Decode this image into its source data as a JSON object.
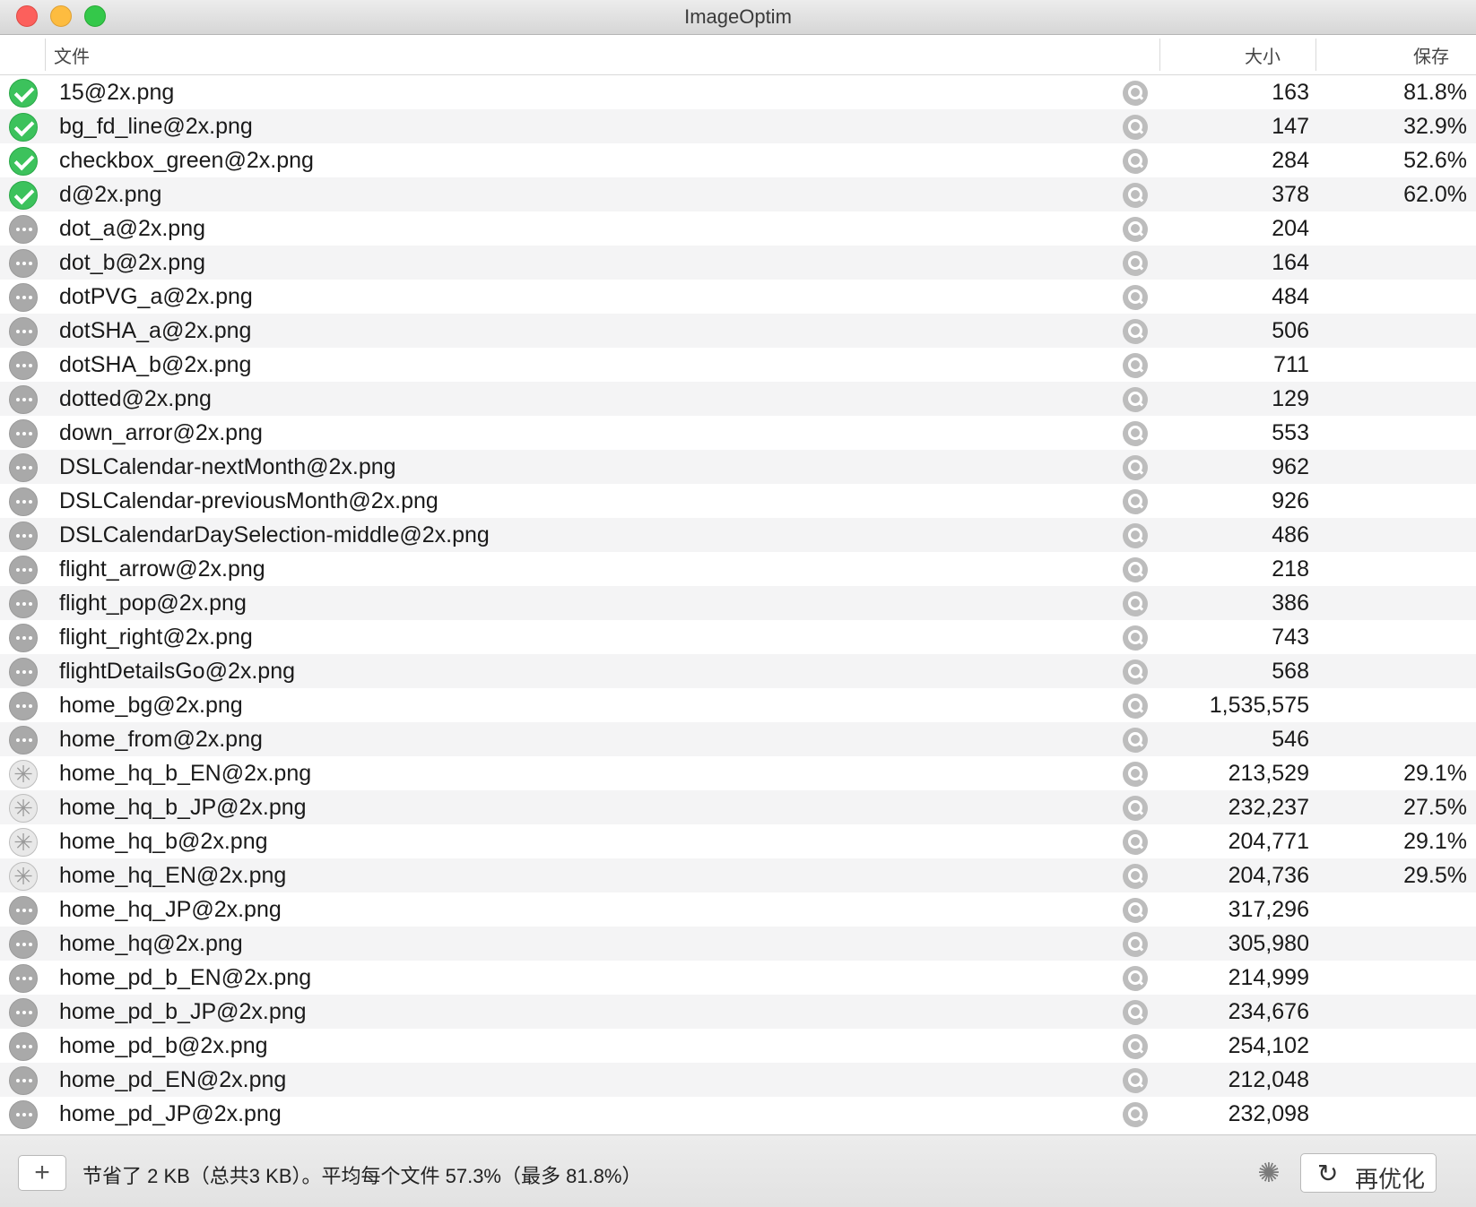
{
  "window": {
    "title": "ImageOptim"
  },
  "columns": {
    "file": "文件",
    "size": "大小",
    "saved": "保存"
  },
  "files": [
    {
      "status": "done",
      "name": "15@2x.png",
      "size": "163",
      "saved": "81.8%"
    },
    {
      "status": "done",
      "name": "bg_fd_line@2x.png",
      "size": "147",
      "saved": "32.9%"
    },
    {
      "status": "done",
      "name": "checkbox_green@2x.png",
      "size": "284",
      "saved": "52.6%"
    },
    {
      "status": "done",
      "name": "d@2x.png",
      "size": "378",
      "saved": "62.0%"
    },
    {
      "status": "waiting",
      "name": "dot_a@2x.png",
      "size": "204",
      "saved": ""
    },
    {
      "status": "waiting",
      "name": "dot_b@2x.png",
      "size": "164",
      "saved": ""
    },
    {
      "status": "waiting",
      "name": "dotPVG_a@2x.png",
      "size": "484",
      "saved": ""
    },
    {
      "status": "waiting",
      "name": "dotSHA_a@2x.png",
      "size": "506",
      "saved": ""
    },
    {
      "status": "waiting",
      "name": "dotSHA_b@2x.png",
      "size": "711",
      "saved": ""
    },
    {
      "status": "waiting",
      "name": "dotted@2x.png",
      "size": "129",
      "saved": ""
    },
    {
      "status": "waiting",
      "name": "down_arror@2x.png",
      "size": "553",
      "saved": ""
    },
    {
      "status": "waiting",
      "name": "DSLCalendar-nextMonth@2x.png",
      "size": "962",
      "saved": ""
    },
    {
      "status": "waiting",
      "name": "DSLCalendar-previousMonth@2x.png",
      "size": "926",
      "saved": ""
    },
    {
      "status": "waiting",
      "name": "DSLCalendarDaySelection-middle@2x.png",
      "size": "486",
      "saved": ""
    },
    {
      "status": "waiting",
      "name": "flight_arrow@2x.png",
      "size": "218",
      "saved": ""
    },
    {
      "status": "waiting",
      "name": "flight_pop@2x.png",
      "size": "386",
      "saved": ""
    },
    {
      "status": "waiting",
      "name": "flight_right@2x.png",
      "size": "743",
      "saved": ""
    },
    {
      "status": "waiting",
      "name": "flightDetailsGo@2x.png",
      "size": "568",
      "saved": ""
    },
    {
      "status": "waiting",
      "name": "home_bg@2x.png",
      "size": "1,535,575",
      "saved": ""
    },
    {
      "status": "waiting",
      "name": "home_from@2x.png",
      "size": "546",
      "saved": ""
    },
    {
      "status": "working",
      "name": "home_hq_b_EN@2x.png",
      "size": "213,529",
      "saved": "29.1%"
    },
    {
      "status": "working",
      "name": "home_hq_b_JP@2x.png",
      "size": "232,237",
      "saved": "27.5%"
    },
    {
      "status": "working",
      "name": "home_hq_b@2x.png",
      "size": "204,771",
      "saved": "29.1%"
    },
    {
      "status": "working",
      "name": "home_hq_EN@2x.png",
      "size": "204,736",
      "saved": "29.5%"
    },
    {
      "status": "waiting",
      "name": "home_hq_JP@2x.png",
      "size": "317,296",
      "saved": ""
    },
    {
      "status": "waiting",
      "name": "home_hq@2x.png",
      "size": "305,980",
      "saved": ""
    },
    {
      "status": "waiting",
      "name": "home_pd_b_EN@2x.png",
      "size": "214,999",
      "saved": ""
    },
    {
      "status": "waiting",
      "name": "home_pd_b_JP@2x.png",
      "size": "234,676",
      "saved": ""
    },
    {
      "status": "waiting",
      "name": "home_pd_b@2x.png",
      "size": "254,102",
      "saved": ""
    },
    {
      "status": "waiting",
      "name": "home_pd_EN@2x.png",
      "size": "212,048",
      "saved": ""
    },
    {
      "status": "waiting",
      "name": "home_pd_JP@2x.png",
      "size": "232,098",
      "saved": ""
    }
  ],
  "footer": {
    "add_label": "+",
    "summary": "节省了 2 KB（总共3 KB）。平均每个文件 57.3%（最多 81.8%）",
    "reoptimize_label": "再优化",
    "reoptimize_icon": "↻"
  }
}
